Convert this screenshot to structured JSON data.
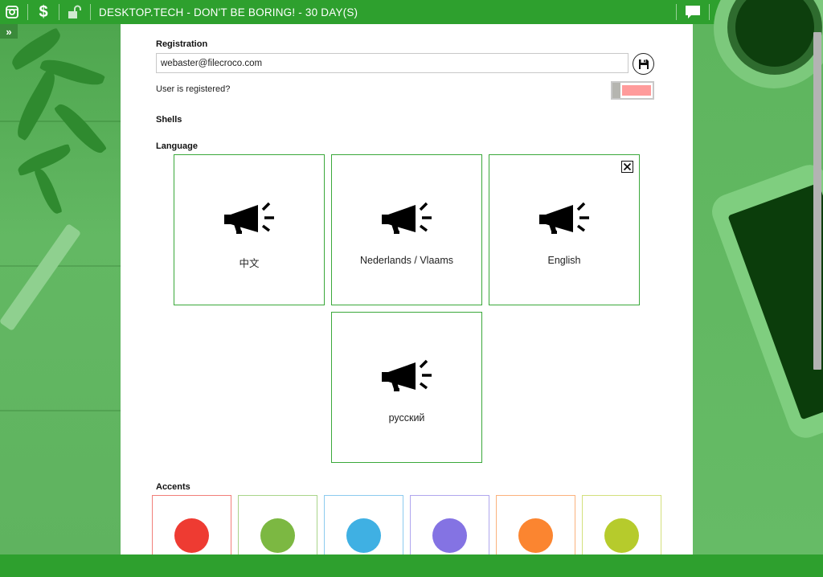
{
  "window": {
    "title": "DESKTOP.TECH - DON'T BE BORING! - 30 DAY(S)"
  },
  "titlebar_icons": {
    "app": "box-icon",
    "dollar": "$",
    "lock": "unlock-icon",
    "chat": "chat-icon",
    "heart": "heart-icon",
    "minimize": "minimize-icon",
    "maximize": "maximize-icon",
    "close": "close-icon"
  },
  "sidebar": {
    "expand_label": "»"
  },
  "registration": {
    "label": "Registration",
    "email_value": "webaster@filecroco.com",
    "registered_label": "User is registered?"
  },
  "shells": {
    "label": "Shells"
  },
  "language": {
    "label": "Language",
    "items": [
      {
        "label": "中文"
      },
      {
        "label": "Nederlands / Vlaams"
      },
      {
        "label": "English",
        "selected": true
      },
      {
        "label": "русский"
      }
    ]
  },
  "accents": {
    "label": "Accents",
    "colors": [
      "#ee3b32",
      "#7cb842",
      "#3fb0e3",
      "#8473e3",
      "#fb8530",
      "#b6cb2c"
    ],
    "borders": [
      "#f17f7a",
      "#a9d48a",
      "#8ccbef",
      "#b0a6ee",
      "#fbb27c",
      "#d3e07c"
    ]
  },
  "theme": {
    "green": "#2ea02e",
    "tile_border": "#3aa83a",
    "toggle_off": "#ff9b9b"
  }
}
